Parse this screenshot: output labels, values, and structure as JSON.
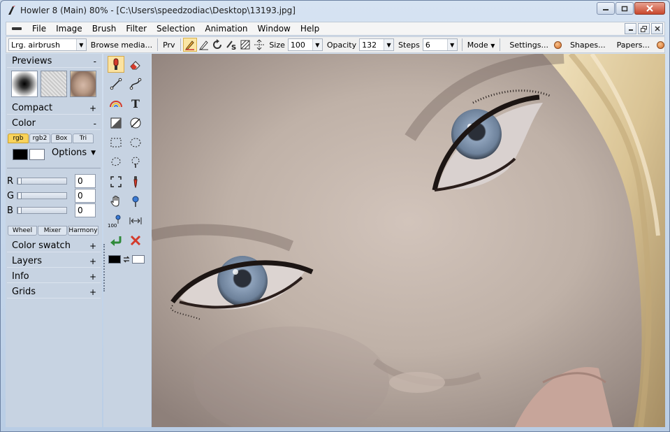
{
  "window": {
    "title": "Howler 8  (Main)   80%   - [C:\\Users\\speedzodiac\\Desktop\\13193.jpg]"
  },
  "menu": {
    "items": [
      "File",
      "Image",
      "Brush",
      "Filter",
      "Selection",
      "Animation",
      "Window",
      "Help"
    ]
  },
  "toolbar": {
    "brush_preset": "Lrg. airbrush",
    "browse_label": "Browse media...",
    "prv_label": "Prv",
    "size_label": "Size",
    "size_value": "100",
    "opacity_label": "Opacity",
    "opacity_value": "132",
    "steps_label": "Steps",
    "steps_value": "6",
    "mode_label": "Mode",
    "settings_label": "Settings...",
    "shapes_label": "Shapes...",
    "papers_label": "Papers..."
  },
  "panel": {
    "previews": {
      "label": "Previews",
      "toggle": "-"
    },
    "compact": {
      "label": "Compact",
      "toggle": "+"
    },
    "color": {
      "label": "Color",
      "toggle": "-"
    },
    "color_tabs": [
      "rgb",
      "rgb2",
      "Box",
      "Tri"
    ],
    "options_label": "Options",
    "sliders": [
      {
        "label": "R",
        "value": "0"
      },
      {
        "label": "G",
        "value": "0"
      },
      {
        "label": "B",
        "value": "0"
      }
    ],
    "bottom_tabs": [
      "Wheel",
      "Mixer",
      "Harmony"
    ],
    "color_swatch": {
      "label": "Color swatch",
      "toggle": "+"
    },
    "layers": {
      "label": "Layers",
      "toggle": "+"
    },
    "info": {
      "label": "Info",
      "toggle": "+"
    },
    "grids": {
      "label": "Grids",
      "toggle": "+"
    }
  },
  "tools": {
    "zoom_badge": "100"
  },
  "colors": {
    "accent_active": "#fbe3a1",
    "foreground": "#000000",
    "background": "#ffffff"
  }
}
